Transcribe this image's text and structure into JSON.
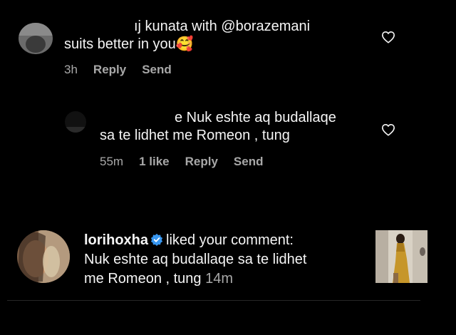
{
  "comment1": {
    "line1": "ıj kunata with @borazemani",
    "line2": "suits better in you",
    "emoji": "🥰",
    "time": "3h",
    "reply_label": "Reply",
    "send_label": "Send"
  },
  "comment2": {
    "line1": "e Nuk eshte aq budallaqe",
    "line2": "sa te lidhet me Romeon , tung",
    "time": "55m",
    "likes": "1 like",
    "reply_label": "Reply",
    "send_label": "Send"
  },
  "notification": {
    "username": "lorihoxha",
    "action": "liked your comment:",
    "line2": "Nuk eshte aq budallaqe sa te lidhet",
    "line3": "me Romeon , tung",
    "time": "14m"
  },
  "icons": {
    "like": "heart-outline-icon",
    "verified": "verified-badge-icon"
  },
  "colors": {
    "background": "#000000",
    "text": "#f5f5f5",
    "secondary": "#a8a8a8",
    "verified": "#3897f0"
  }
}
